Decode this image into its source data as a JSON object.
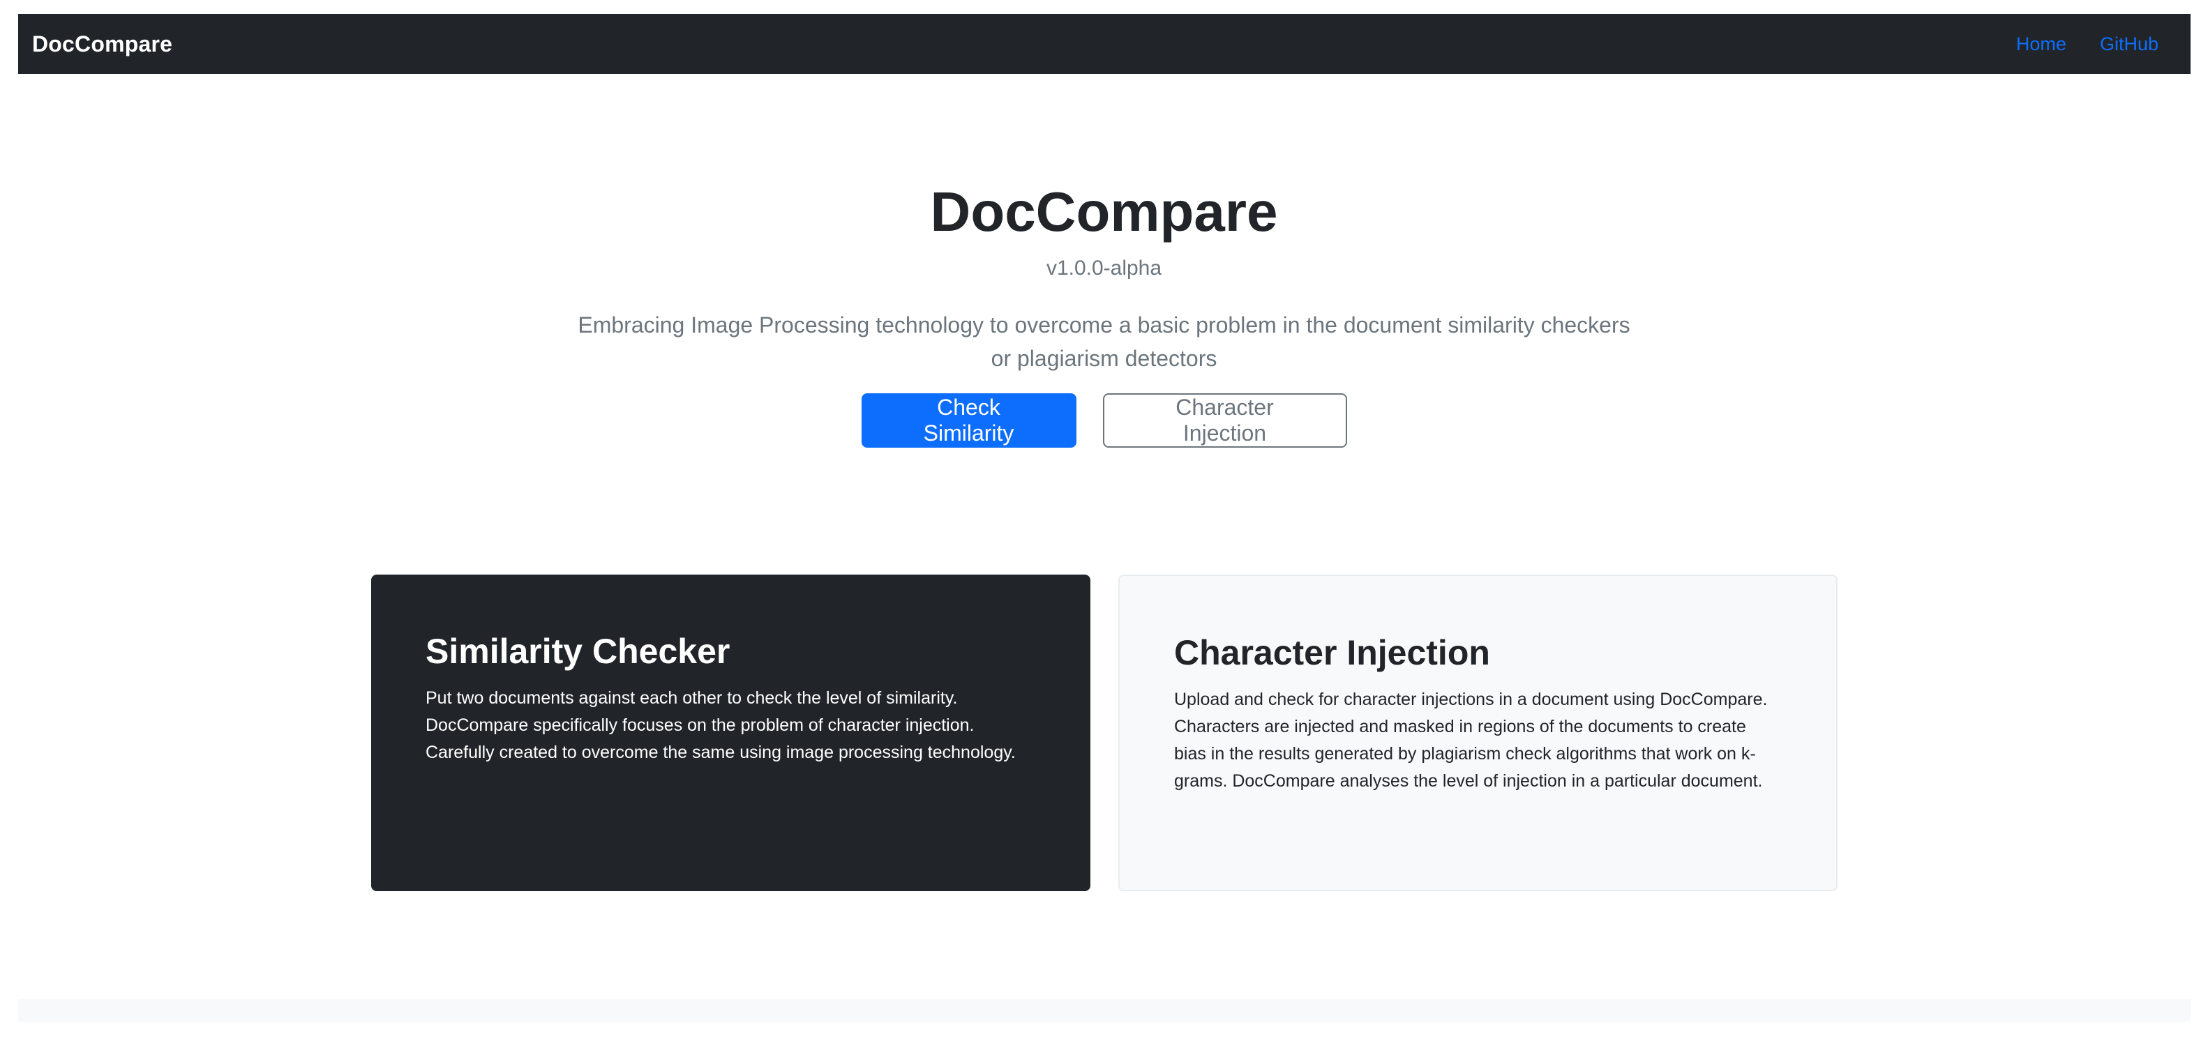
{
  "navbar": {
    "brand": "DocCompare",
    "links": [
      {
        "label": "Home"
      },
      {
        "label": "GitHub"
      }
    ]
  },
  "hero": {
    "title": "DocCompare",
    "version": "v1.0.0-alpha",
    "lead": "Embracing Image Processing technology to overcome a basic problem in the document similarity checkers or plagiarism detectors",
    "buttons": {
      "primary": "Check Similarity",
      "secondary": "Character Injection"
    }
  },
  "cards": [
    {
      "title": "Similarity Checker",
      "text": "Put two documents against each other to check the level of similarity. DocCompare specifically focuses on the problem of character injection. Carefully created to overcome the same using image processing technology."
    },
    {
      "title": "Character Injection",
      "text": "Upload and check for character injections in a document using DocCompare. Characters are injected and masked in regions of the documents to create bias in the results generated by plagiarism check algorithms that work on k-grams. DocCompare analyses the level of injection in a particular document."
    }
  ],
  "colors": {
    "navbar_bg": "#212529",
    "link": "#0d6efd",
    "primary": "#0d6efd",
    "muted": "#6c757d",
    "light_bg": "#f8f9fa"
  }
}
